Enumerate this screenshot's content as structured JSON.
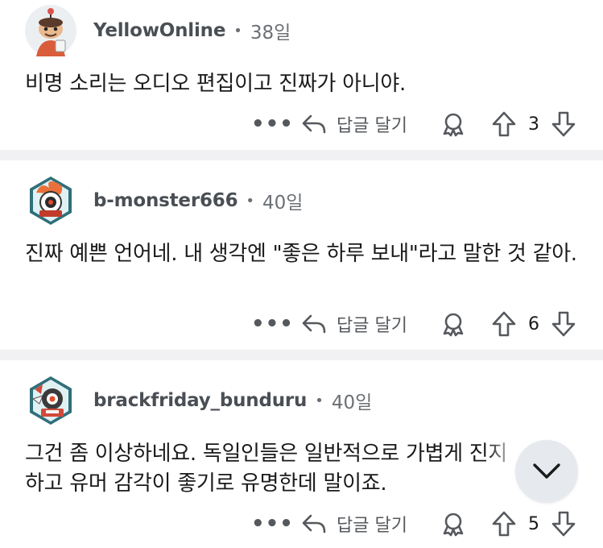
{
  "comments": [
    {
      "username": "YellowOnline",
      "time": "38일",
      "text": "비명 소리는 오디오 편집이고 진짜가 아니야.",
      "reply_label": "답글 달기",
      "vote_count": "3",
      "avatar_icon": "snoo-avatar-icon"
    },
    {
      "username": "b-monster666",
      "time": "40일",
      "text": "진짜 예쁜 언어네. 내 생각엔 \"좋은 하루 보내\"라고 말한 것 같아.",
      "reply_label": "답글 달기",
      "vote_count": "6",
      "avatar_icon": "robot-avatar-icon"
    },
    {
      "username": "brackfriday_bunduru",
      "time": "40일",
      "text": "그건 좀 이상하네요. 독일인들은 일반적으로 가볍게 진지하고 유머 감각이 좋기로 유명한데 말이죠.",
      "reply_label": "답글 달기",
      "vote_count": "5",
      "avatar_icon": "robot-avatar-icon"
    }
  ],
  "separator": "•",
  "more_glyph": "•••",
  "colors": {
    "text_primary": "#1a1a1b",
    "text_secondary": "#6b7075",
    "divider": "#f1f1f3",
    "fab_bg": "#e6eaee"
  },
  "icons": [
    "more-icon",
    "reply-arrow-icon",
    "award-icon",
    "upvote-icon",
    "downvote-icon",
    "chevron-down-icon"
  ]
}
